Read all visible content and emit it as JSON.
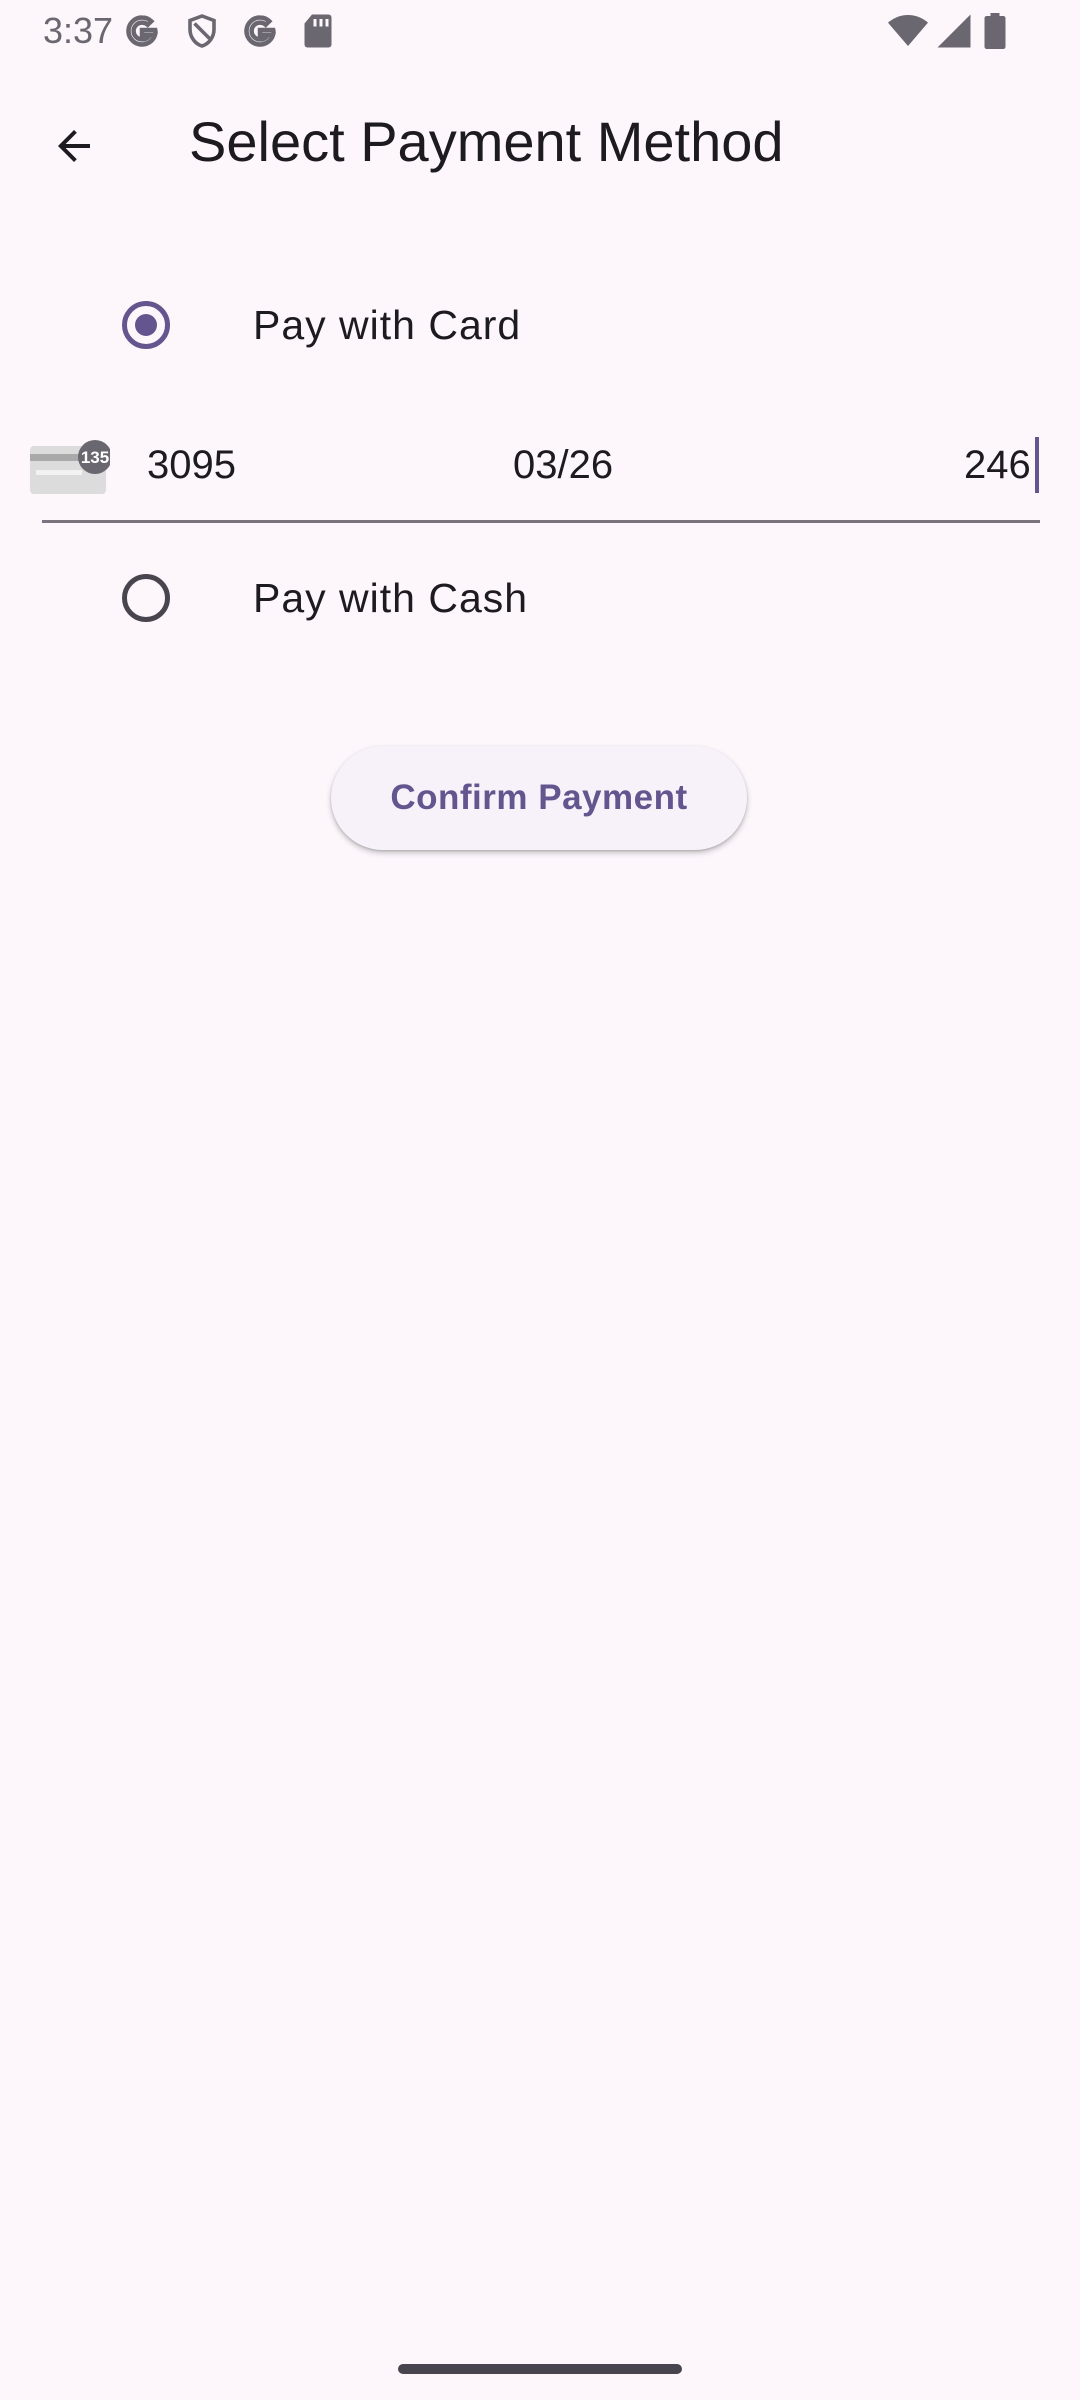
{
  "status_bar": {
    "time": "3:37",
    "left_icons": [
      "google-icon",
      "shield-icon",
      "google-icon",
      "sd-card-icon"
    ],
    "right_icons": [
      "wifi-icon",
      "cell-signal-icon",
      "battery-icon"
    ]
  },
  "app_bar": {
    "back_icon": "arrow-back-icon",
    "title": "Select Payment Method"
  },
  "options": [
    {
      "label": "Pay with Card",
      "selected": true
    },
    {
      "label": "Pay with Cash",
      "selected": false
    }
  ],
  "card_input": {
    "brand_icon": "generic-card-icon",
    "brand_badge": "135",
    "number_last4": "3095",
    "expiry": "03/26",
    "cvc": "246"
  },
  "confirm_label": "Confirm Payment",
  "colors": {
    "background": "#fdf7fc",
    "primary": "#65558f",
    "text": "#1d1b20",
    "outline": "#79747e"
  }
}
